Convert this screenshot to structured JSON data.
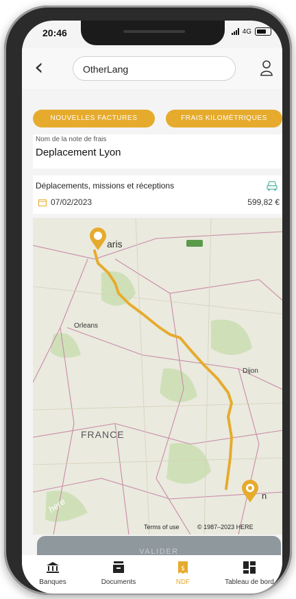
{
  "status": {
    "time": "20:46",
    "network": "4G"
  },
  "header": {
    "title": "OtherLang"
  },
  "actions": {
    "new_invoices": "NOUVELLES FACTURES",
    "mileage_costs": "FRAIS KILOMÉTRIQUES"
  },
  "note": {
    "label": "Nom de la note de frais",
    "value": "Deplacement Lyon"
  },
  "expense": {
    "category": "Déplacements, missions et réceptions",
    "date": "07/02/2023",
    "amount": "599,82 €"
  },
  "map": {
    "labels": {
      "paris": "aris",
      "orleans": "Orleans",
      "dijon": "Dijon",
      "france": "FRANCE",
      "lyon": "n",
      "here_logo": "here"
    },
    "terms": "Terms of use",
    "copyright": "© 1987–2023 HERE",
    "colors": {
      "route": "#e6ab2d",
      "land": "#eaeadf",
      "forest": "#cfe0b8",
      "roads": "#c98aa6"
    }
  },
  "validate": {
    "label": "VALIDER"
  },
  "tabs": [
    {
      "label": "Banques",
      "icon": "bank-icon"
    },
    {
      "label": "Documents",
      "icon": "document-icon"
    },
    {
      "label": "NDF",
      "icon": "receipt-icon",
      "active": true
    },
    {
      "label": "Tableau de bord",
      "icon": "dashboard-icon"
    }
  ],
  "colors": {
    "accent": "#e6ab2d",
    "validate_bg": "#8f989d"
  }
}
